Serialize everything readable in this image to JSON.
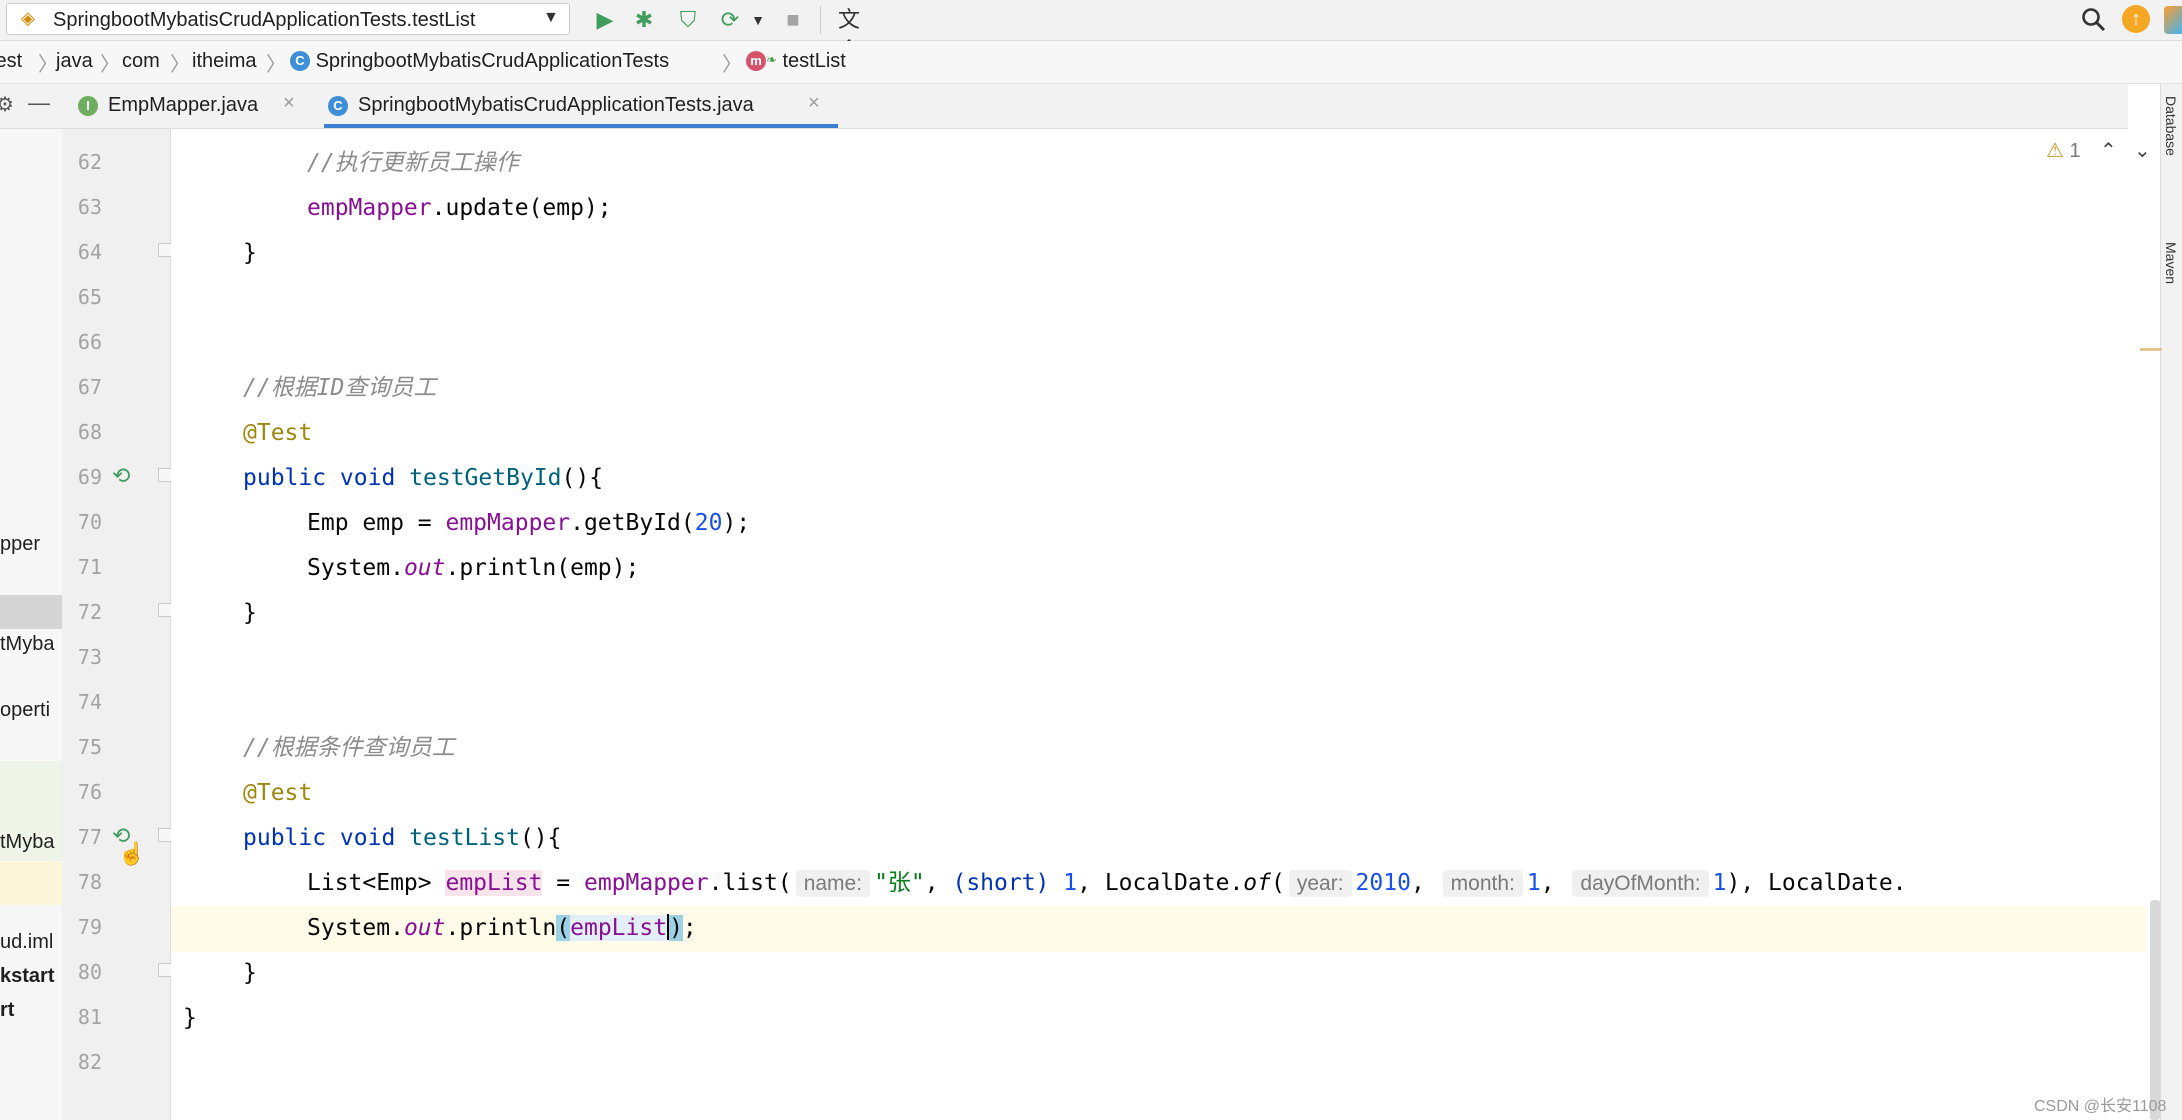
{
  "toolbar": {
    "run_config": "SpringbootMybatisCrudApplicationTests.testList",
    "icons": [
      "run-icon",
      "debug-icon",
      "coverage-icon",
      "profiler-icon",
      "dropdown-icon",
      "stop-icon",
      "translate-icon",
      "search-icon",
      "update-icon"
    ]
  },
  "breadcrumb": {
    "items": [
      "test",
      "java",
      "com",
      "itheima",
      "SpringbootMybatisCrudApplicationTests",
      "testList"
    ]
  },
  "tabs": [
    {
      "label": "EmpMapper.java",
      "active": false
    },
    {
      "label": "SpringbootMybatisCrudApplicationTests.java",
      "active": true
    }
  ],
  "right_tools": [
    "Database",
    "Maven"
  ],
  "project_panel": [
    "pper",
    "tMyba",
    "operti",
    "tMyba",
    "ud.iml",
    "kstart",
    "rt"
  ],
  "editor": {
    "warning_count": "1",
    "line_numbers": [
      "62",
      "63",
      "64",
      "65",
      "66",
      "67",
      "68",
      "69",
      "70",
      "71",
      "72",
      "73",
      "74",
      "75",
      "76",
      "77",
      "78",
      "79",
      "80",
      "81",
      "82"
    ],
    "lines": {
      "l62_comment": "//执行更新员工操作",
      "l63_field": "empMapper",
      "l63_rest": ".update(emp);",
      "l64": "}",
      "l67_comment": "//根据ID查询员工",
      "l68_annotation": "@Test",
      "l69_kw": "public void ",
      "l69_fn": "testGetById",
      "l69_rest": "(){",
      "l70_a": "Emp emp = ",
      "l70_field": "empMapper",
      "l70_b": ".getById(",
      "l70_num": "20",
      "l70_c": ");",
      "l71_a": "System.",
      "l71_out": "out",
      "l71_b": ".println(emp);",
      "l72": "}",
      "l75_comment": "//根据条件查询员工",
      "l76_annotation": "@Test",
      "l77_kw": "public void ",
      "l77_fn": "testList",
      "l77_rest": "(){",
      "l78_type": "List<Emp> ",
      "l78_var": "empList",
      "l78_eq": " = ",
      "l78_field": "empMapper",
      "l78_call": ".list(",
      "l78_hint_name": "name:",
      "l78_str": "\"张\"",
      "l78_comma1": ", ",
      "l78_cast": "(short)",
      "l78_sp": " ",
      "l78_num1": "1",
      "l78_comma2": ", LocalDate.",
      "l78_of": "of",
      "l78_paren": "(",
      "l78_hint_year": "year:",
      "l78_year": "2010",
      "l78_comma3": ", ",
      "l78_hint_month": "month:",
      "l78_month": "1",
      "l78_comma4": ", ",
      "l78_hint_day": "dayOfMonth:",
      "l78_day": "1",
      "l78_tail": "), LocalDate.",
      "l79_a": "System.",
      "l79_out": "out",
      "l79_b": ".println",
      "l79_open": "(",
      "l79_var": "empList",
      "l79_close": ")",
      "l79_end": ";",
      "l80": "}",
      "l81": "}"
    }
  },
  "watermark": "CSDN @长安1108"
}
